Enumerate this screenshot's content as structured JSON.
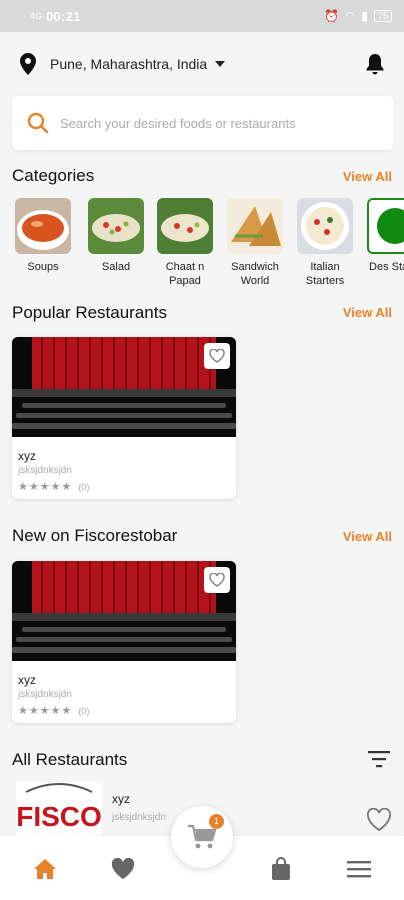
{
  "status_bar": {
    "network": "4G",
    "time": "00:21",
    "battery": "75"
  },
  "location": {
    "text": "Pune, Maharashtra, India"
  },
  "search": {
    "placeholder": "Search your desired foods or restaurants"
  },
  "sections": {
    "categories": {
      "title": "Categories",
      "view_all": "View All"
    },
    "popular": {
      "title": "Popular Restaurants",
      "view_all": "View All"
    },
    "new": {
      "title": "New on Fiscorestobar",
      "view_all": "View All"
    },
    "all": {
      "title": "All Restaurants"
    }
  },
  "categories": [
    {
      "label": "Soups"
    },
    {
      "label": "Salad"
    },
    {
      "label": "Chaat n Papad"
    },
    {
      "label": "Sandwich World"
    },
    {
      "label": "Italian Starters"
    },
    {
      "label": "Des Starte"
    }
  ],
  "popular_restaurants": [
    {
      "name": "xyz",
      "subtitle": "jsksjdnksjdn",
      "stars": "★★★★★",
      "rating_count": "(0)"
    }
  ],
  "new_restaurants": [
    {
      "name": "xyz",
      "subtitle": "jsksjdnksjdn",
      "stars": "★★★★★",
      "rating_count": "(0)"
    }
  ],
  "all_restaurants": [
    {
      "logo_text": "FISCO",
      "name": "xyz",
      "subtitle": "jsksjdnksjdn"
    }
  ],
  "cart": {
    "badge": "1"
  },
  "colors": {
    "accent": "#e8822a",
    "statusbar": "#d9d9d9",
    "background": "#f5f5f5"
  },
  "icons": [
    "location-pin-icon",
    "bell-icon",
    "search-icon",
    "heart-icon",
    "filter-icon",
    "home-icon",
    "cart-icon",
    "bag-icon",
    "menu-icon"
  ]
}
